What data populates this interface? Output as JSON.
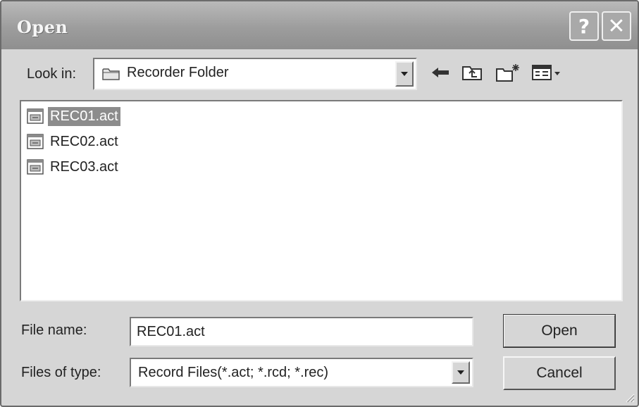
{
  "window": {
    "title": "Open"
  },
  "titlebar_buttons": {
    "help": "?",
    "close": "✕"
  },
  "look_in": {
    "label": "Look in:",
    "value": "Recorder  Folder"
  },
  "toolbar_icons": [
    "back-arrow-icon",
    "up-one-level-icon",
    "create-new-folder-icon",
    "view-menu-icon"
  ],
  "files": [
    {
      "name": "REC01.act",
      "selected": true
    },
    {
      "name": "REC02.act",
      "selected": false
    },
    {
      "name": "REC03.act",
      "selected": false
    }
  ],
  "file_name": {
    "label": "File name:",
    "value": "REC01.act"
  },
  "file_type": {
    "label": "Files of type:",
    "value": "Record Files(*.act; *.rcd; *.rec)"
  },
  "buttons": {
    "open": "Open",
    "cancel": "Cancel"
  },
  "colors": {
    "selection": "#8c8c8c",
    "dialog_bg": "#d6d6d6",
    "titlebar": "#a3a3a3"
  }
}
